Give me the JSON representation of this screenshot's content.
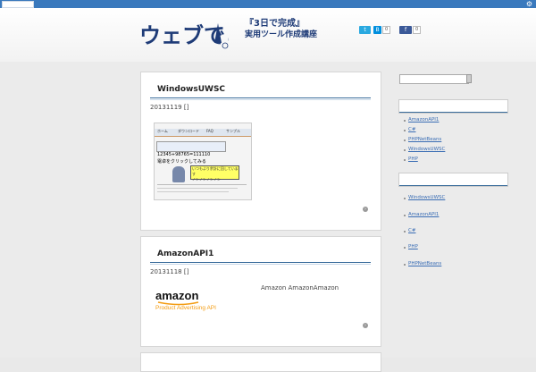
{
  "topbar": {
    "icon": "gear-icon"
  },
  "header": {
    "logo_text": "ウェブでこ",
    "tagline_line1": "『3日で完成』",
    "tagline_line2": "実用ツール作成講座",
    "social": {
      "twitter_count": "",
      "hatena_count": "0",
      "facebook_count": "0"
    }
  },
  "posts": [
    {
      "title": "WindowsUWSC",
      "date": "20131119 []",
      "excerpt": "",
      "thumb_texts": [
        "ホーム",
        "ダウンロード",
        "FAQ",
        "サンプル",
        "12345+98765=111110",
        "電卓をクリックしてみる",
        "いつもより余計に回しています",
        "ノ＞ノ＞ノ＞ノ＞"
      ]
    },
    {
      "title": "AmazonAPI1",
      "date": "20131118 []",
      "excerpt": "Amazon AmazonAmazon",
      "logo_text": "amazon",
      "logo_sub": "Product Advertising API"
    }
  ],
  "sidebar": {
    "search_placeholder": "",
    "widget1_links": [
      "AmazonAPI1",
      "C#",
      "PHPNetBeans",
      "WindowsUWSC",
      "PHP"
    ],
    "widget2_links": [
      "WindowsUWSC",
      "AmazonAPI1",
      "C#",
      "PHP",
      "PHPNetBeans"
    ]
  },
  "colors": {
    "topbar": "#3a79bd",
    "accent_line": "#3a6d9c",
    "link": "#3a6db4",
    "amazon_orange": "#f39c12"
  }
}
